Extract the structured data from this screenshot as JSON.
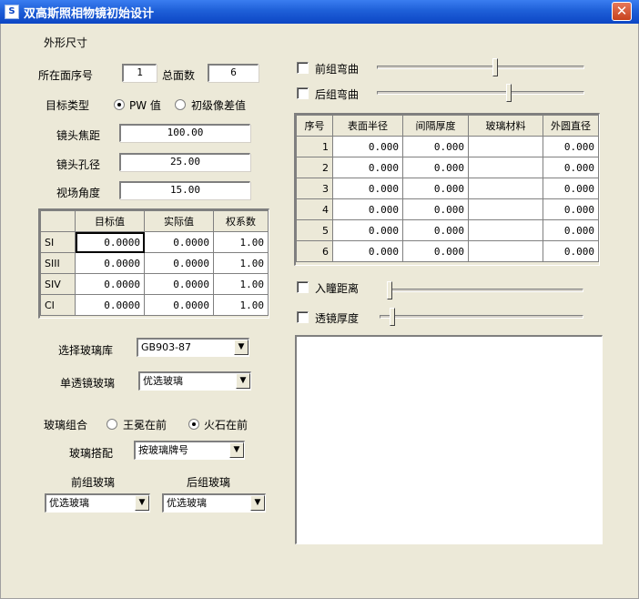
{
  "window": {
    "title": "双高斯照相物镜初始设计",
    "app_icon": "S",
    "close_glyph": "✕"
  },
  "shape_section": {
    "title": "外形尺寸"
  },
  "surface": {
    "current_label": "所在面序号",
    "current_value": "1",
    "total_label": "总面数",
    "total_value": "6"
  },
  "target_type": {
    "label": "目标类型",
    "options": [
      {
        "label": "PW 值",
        "checked": true
      },
      {
        "label": "初级像差值",
        "checked": false
      }
    ]
  },
  "lens_params": [
    {
      "label": "镜头焦距",
      "value": "100.00"
    },
    {
      "label": "镜头孔径",
      "value": "25.00"
    },
    {
      "label": "视场角度",
      "value": "15.00"
    }
  ],
  "aberration_table": {
    "headers": [
      "",
      "目标值",
      "实际值",
      "权系数"
    ],
    "rows": [
      {
        "name": "SI",
        "target": "0.0000",
        "actual": "0.0000",
        "weight": "1.00"
      },
      {
        "name": "SIII",
        "target": "0.0000",
        "actual": "0.0000",
        "weight": "1.00"
      },
      {
        "name": "SIV",
        "target": "0.0000",
        "actual": "0.0000",
        "weight": "1.00"
      },
      {
        "name": "CI",
        "target": "0.0000",
        "actual": "0.0000",
        "weight": "1.00"
      }
    ]
  },
  "glass_library": {
    "label": "选择玻璃库",
    "value": "GB903-87"
  },
  "single_glass": {
    "label": "单透镜玻璃",
    "value": "优选玻璃"
  },
  "glass_combo": {
    "label": "玻璃组合",
    "options": [
      {
        "label": "王冕在前",
        "checked": false
      },
      {
        "label": "火石在前",
        "checked": true
      }
    ]
  },
  "glass_match": {
    "label": "玻璃搭配",
    "value": "按玻璃牌号"
  },
  "front_glass": {
    "label": "前组玻璃",
    "value": "优选玻璃"
  },
  "rear_glass": {
    "label": "后组玻璃",
    "value": "优选玻璃"
  },
  "bend": {
    "front_label": "前组弯曲",
    "rear_label": "后组弯曲",
    "front_level": 0.57,
    "rear_level": 0.64
  },
  "surface_table": {
    "headers": [
      "序号",
      "表面半径",
      "间隔厚度",
      "玻璃材料",
      "外圆直径"
    ],
    "rows": [
      {
        "no": "1",
        "radius": "0.000",
        "thickness": "0.000",
        "glass": "",
        "diameter": "0.000"
      },
      {
        "no": "2",
        "radius": "0.000",
        "thickness": "0.000",
        "glass": "",
        "diameter": "0.000"
      },
      {
        "no": "3",
        "radius": "0.000",
        "thickness": "0.000",
        "glass": "",
        "diameter": "0.000"
      },
      {
        "no": "4",
        "radius": "0.000",
        "thickness": "0.000",
        "glass": "",
        "diameter": "0.000"
      },
      {
        "no": "5",
        "radius": "0.000",
        "thickness": "0.000",
        "glass": "",
        "diameter": "0.000"
      },
      {
        "no": "6",
        "radius": "0.000",
        "thickness": "0.000",
        "glass": "",
        "diameter": "0.000"
      }
    ]
  },
  "distance": {
    "pupil_label": "入瞳距离",
    "lens_thickness_label": "透镜厚度",
    "pupil_level": 0.0,
    "thickness_level": 0.05
  }
}
